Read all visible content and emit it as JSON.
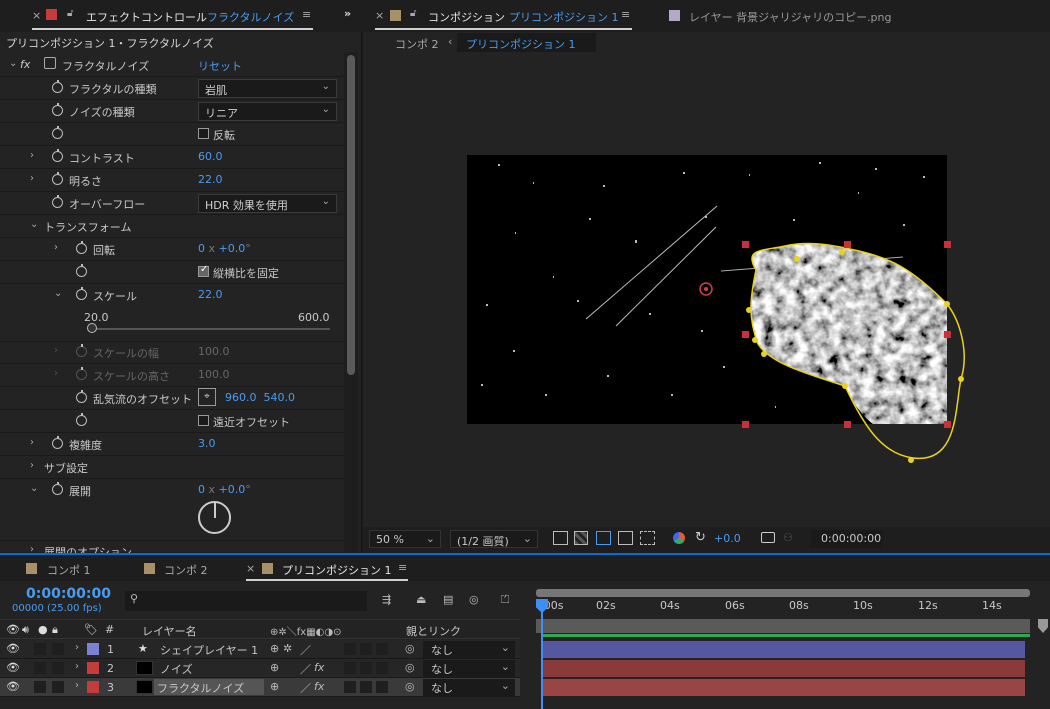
{
  "effect_panel": {
    "tab_title": "エフェクトコントロール",
    "tab_target": "フラクタルノイズ",
    "breadcrumb": "プリコンポジション 1・フラクタルノイズ",
    "effect_name": "フラクタルノイズ",
    "reset_label": "リセット",
    "fx_label": "fx",
    "properties": {
      "fractal_type": {
        "label": "フラクタルの種類",
        "value": "岩肌"
      },
      "noise_type": {
        "label": "ノイズの種類",
        "value": "リニア"
      },
      "invert": {
        "label": "反転"
      },
      "contrast": {
        "label": "コントラスト",
        "value": "60.0"
      },
      "brightness": {
        "label": "明るさ",
        "value": "22.0"
      },
      "overflow": {
        "label": "オーバーフロー",
        "value": "HDR 効果を使用"
      },
      "transform": {
        "label": "トランスフォーム"
      },
      "rotation": {
        "label": "回転",
        "turns": "0",
        "degrees": "+0.0"
      },
      "uniform_scale": {
        "label": "縦横比を固定"
      },
      "scale": {
        "label": "スケール",
        "value": "22.0",
        "slider_min": "20.0",
        "slider_max": "600.0",
        "slider_fraction": 0.003
      },
      "scale_width": {
        "label": "スケールの幅",
        "value": "100.0"
      },
      "scale_height": {
        "label": "スケールの高さ",
        "value": "100.0"
      },
      "offset_turbulence": {
        "label": "乱気流のオフセット",
        "value": "960.0  540.0"
      },
      "perspective_offset": {
        "label": "遠近オフセット"
      },
      "complexity": {
        "label": "複雑度",
        "value": "3.0"
      },
      "sub_settings": {
        "label": "サブ設定"
      },
      "evolution": {
        "label": "展開",
        "turns": "0",
        "degrees": "+0.0"
      },
      "evolution_options": {
        "label": "展開のオプション"
      }
    }
  },
  "comp_panel": {
    "tab_title": "コンポジション",
    "tab_target": "プリコンポジション 1",
    "other_tab": "レイヤー  背景ジャリジャリのコピー.png",
    "breadcrumb_prev": "コンポ 2",
    "breadcrumb_current": "プリコンポジション 1",
    "footer": {
      "zoom": "50 %",
      "resolution": "(1/2 画質)",
      "exposure": "+0.0",
      "timecode": "0:00:00:00"
    }
  },
  "timeline": {
    "tabs": [
      {
        "label": "コンポ 1"
      },
      {
        "label": "コンポ 2"
      },
      {
        "label": "プリコンポジション 1"
      }
    ],
    "timecode": "0:00:00:00",
    "frame_info": "00000 (25.00 fps)",
    "search_placeholder": "",
    "col_num": "#",
    "col_layer_name": "レイヤー名",
    "col_parent": "親とリンク",
    "ruler_start": ":00s",
    "ruler_ticks": [
      "02s",
      "04s",
      "06s",
      "08s",
      "10s",
      "12s",
      "14s"
    ],
    "layers": [
      {
        "index": "1",
        "name": "シェイプレイヤー 1",
        "parent": "なし",
        "color": "#7b82d6",
        "bar_color": "#5558a0"
      },
      {
        "index": "2",
        "name": "ノイズ",
        "parent": "なし",
        "color": "#c43c3c",
        "bar_color": "#8a3a3a"
      },
      {
        "index": "3",
        "name": "フラクタルノイズ",
        "parent": "なし",
        "color": "#c43c3c",
        "bar_color": "#9a4545"
      }
    ]
  },
  "colors": {
    "accent_blue": "#4a9cf0",
    "mask_yellow": "#e8d21f",
    "handle_red": "#c9303a"
  }
}
